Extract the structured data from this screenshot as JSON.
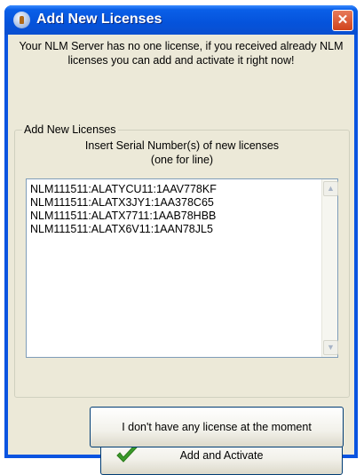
{
  "window": {
    "title": "Add New Licenses",
    "close_symbol": "✕"
  },
  "message": "Your NLM Server has no one license, if you received already NLM licenses you can add and activate it right now!",
  "group": {
    "legend": "Add New Licenses",
    "instruction_line1": "Insert Serial Number(s) of new licenses",
    "instruction_line2": "(one for line)",
    "serial_text": "NLM111511:ALATYCU11:1AAV778KF\nNLM111511:ALATX3JY1:1AA378C65\nNLM111511:ALATX7711:1AAB78HBB\nNLM111511:ALATX6V11:1AAN78JL5"
  },
  "buttons": {
    "activate_label": "Add and Activate",
    "no_license_label": "I don't have any license at the moment"
  },
  "icons": {
    "app": "nlm-app-icon",
    "activate": "green-checkmark-icon",
    "scroll_up": "scroll-up-arrow-icon",
    "scroll_down": "scroll-down-arrow-icon"
  },
  "colors": {
    "titlebar": "#0553db",
    "client_bg": "#ece9d8",
    "close_button": "#d0431c",
    "check": "#3a9a2a"
  }
}
